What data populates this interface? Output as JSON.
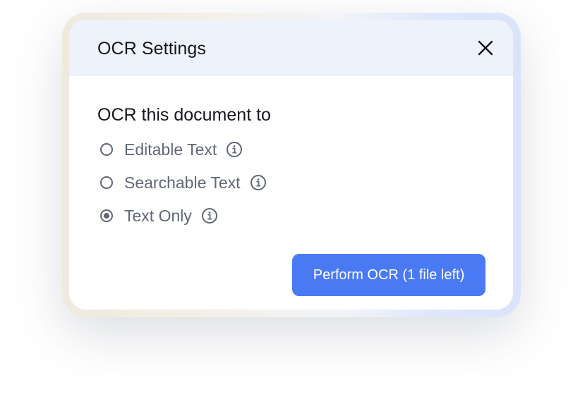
{
  "dialog": {
    "title": "OCR Settings",
    "close_icon": "close-icon",
    "section_heading": "OCR this document to",
    "options": [
      {
        "label": "Editable Text",
        "selected": false,
        "icon": "info-icon"
      },
      {
        "label": "Searchable Text",
        "selected": false,
        "icon": "info-icon"
      },
      {
        "label": "Text Only",
        "selected": true,
        "icon": "info-icon"
      }
    ],
    "primary_button_label": "Perform OCR (1 file left)"
  },
  "colors": {
    "header_bg": "#eef2fa",
    "primary": "#4a7af3",
    "text_dark": "#15171c",
    "text_muted": "#606775"
  }
}
